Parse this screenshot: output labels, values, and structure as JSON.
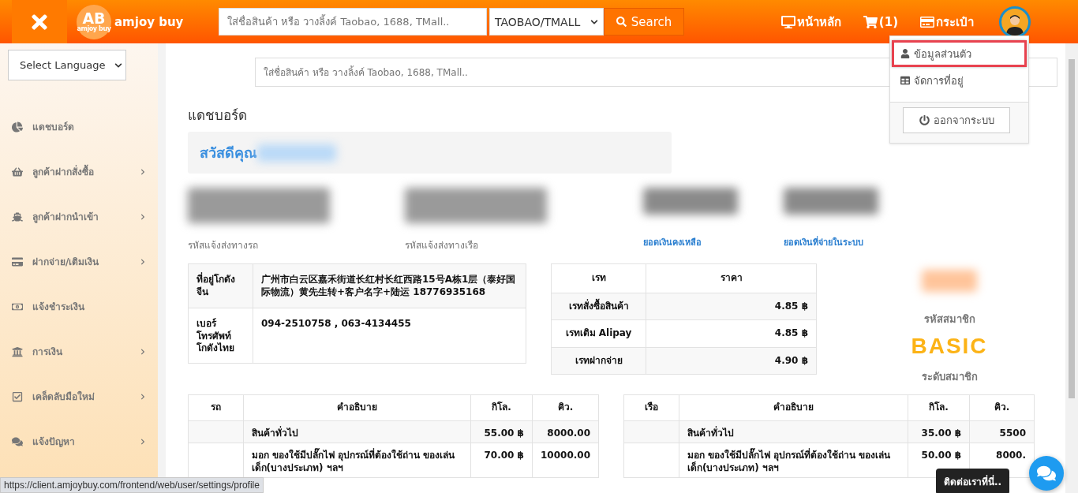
{
  "header": {
    "logo": {
      "mark": "AB",
      "tagline": "amjoy buy",
      "name": "amjoy buy"
    },
    "search": {
      "placeholder": "ใส่ชื่อสินค้า หรือ วางลิ้งค์ Taobao, 1688, TMall.."
    },
    "source_select": {
      "value": "TAOBAO/TMALL"
    },
    "search_button": "Search",
    "nav": [
      {
        "kind": "home",
        "label": "หน้าหลัก"
      },
      {
        "kind": "cart",
        "label": "(1)"
      },
      {
        "kind": "wallet",
        "label": "กระเป๋า"
      }
    ]
  },
  "user_menu": {
    "expanded": true,
    "items": [
      {
        "kind": "profile",
        "label": "ข้อมูลส่วนตัว",
        "selected": true
      },
      {
        "kind": "address",
        "label": "จัดการที่อยู่",
        "selected": false
      }
    ],
    "logout": "ออกจากระบบ"
  },
  "sidebar": {
    "language_select": {
      "value": "Select Language"
    },
    "items": [
      {
        "kind": "pie",
        "label": "แดชบอร์ด",
        "has_submenu": false
      },
      {
        "kind": "basket",
        "label": "ลูกค้าฝากสั่งซื้อ",
        "has_submenu": true
      },
      {
        "kind": "ship",
        "label": "ลูกค้าฝากนำเข้า",
        "has_submenu": true
      },
      {
        "kind": "card",
        "label": "ฝากจ่าย/เติมเงิน",
        "has_submenu": true
      },
      {
        "kind": "money",
        "label": "แจ้งชำระเงิน",
        "has_submenu": false
      },
      {
        "kind": "bank",
        "label": "การเงิน",
        "has_submenu": true
      },
      {
        "kind": "check",
        "label": "เคล็ดลับมือใหม่",
        "has_submenu": true
      },
      {
        "kind": "chat",
        "label": "แจ้งปัญหา",
        "has_submenu": true
      }
    ]
  },
  "main": {
    "search": {
      "placeholder": "ใส่ชื่อสินค้า หรือ วางลิ้งค์ Taobao, 1688, TMall.."
    },
    "title": "แดชบอร์ด",
    "greeting": "สวัสดีคุณ",
    "stats": [
      {
        "kind": "code",
        "label": "รหัสแจ้งส่งทางรถ"
      },
      {
        "kind": "code",
        "label": "รหัสแจ้งส่งทางเรือ"
      },
      {
        "kind": "balance",
        "label": "ยอดเงินคงเหลือ"
      },
      {
        "kind": "balance",
        "label": "ยอดเงินที่จ่ายในระบบ"
      }
    ],
    "warehouse": [
      {
        "label": "ที่อยู่โกดังจีน",
        "value": "广州市白云区嘉禾街道长红村长红西路15号A栋1层（泰好国际物流）黄先生转+客户名字+陆运 18776935168"
      },
      {
        "label": "เบอร์โทรศัพท์โกดังไทย",
        "value": "094-2510758 , 063-4134455"
      }
    ],
    "rates": {
      "columns": [
        "เรท",
        "ราคา"
      ],
      "rows": [
        [
          "เรทสั่งซื้อสินค้า",
          "4.85 ฿"
        ],
        [
          "เรทเติม Alipay",
          "4.85 ฿"
        ],
        [
          "เรทฝากจ่าย",
          "4.90 ฿"
        ]
      ]
    },
    "member": {
      "code_label": "รหัสสมาชิก",
      "level": "BASIC",
      "level_label": "ระดับสมาชิก"
    },
    "shipping_tables": [
      {
        "columns": [
          "รถ",
          "คำอธิบาย",
          "กิโล.",
          "คิว."
        ],
        "rows": [
          [
            "",
            "สินค้าทั่วไป",
            "55.00 ฿",
            "8000.00"
          ],
          [
            "",
            "มอก ของใช้มีปลั๊กไฟ อุปกรณ์ที่ต้องใช้ถ่าน ของเล่นเด็ก(บางประเภท) ฯลฯ",
            "70.00 ฿",
            "10000.00"
          ]
        ]
      },
      {
        "columns": [
          "เรือ",
          "คำอธิบาย",
          "กิโล.",
          "คิว."
        ],
        "rows": [
          [
            "",
            "สินค้าทั่วไป",
            "35.00 ฿",
            "5500"
          ],
          [
            "",
            "มอก ของใช้มีปลั๊กไฟ อุปกรณ์ที่ต้องใช้ถ่าน ของเล่นเด็ก(บางประเภท) ฯลฯ",
            "50.00 ฿",
            "8000."
          ]
        ]
      }
    ]
  },
  "chat": {
    "tooltip": "ติดต่อเราที่นี่.."
  },
  "status_url": "https://client.amjoybuy.com/frontend/web/user/settings/profile"
}
